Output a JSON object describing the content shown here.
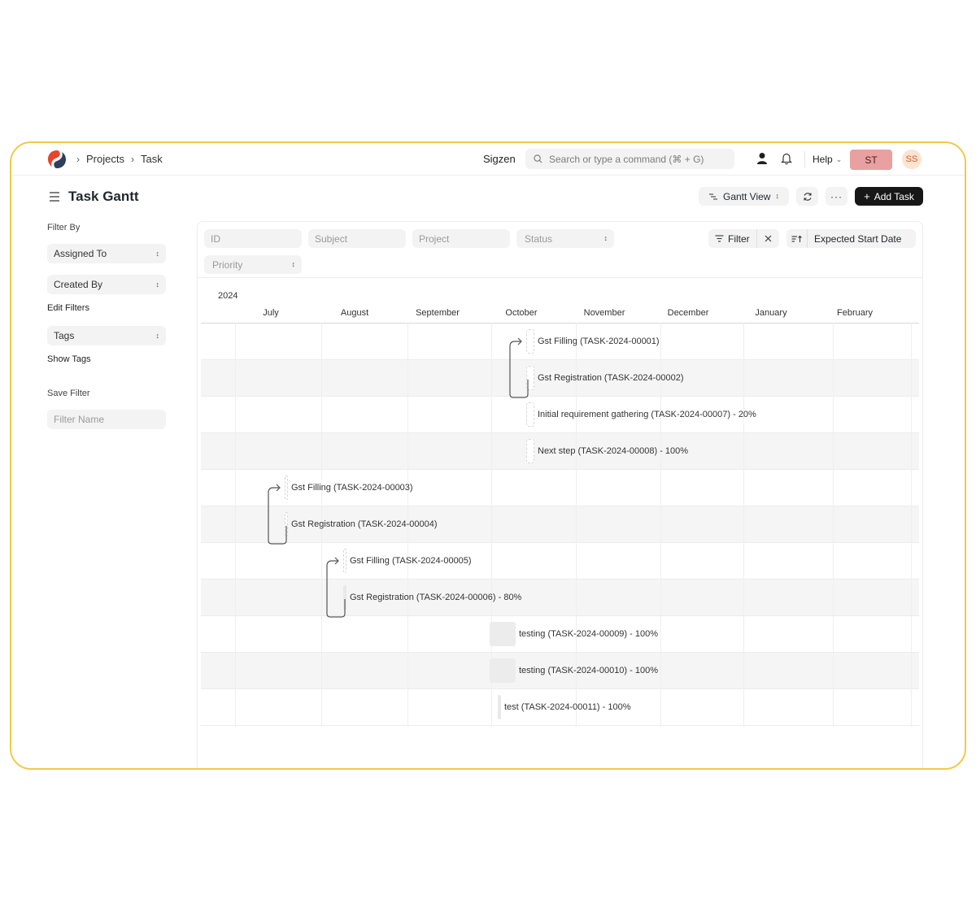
{
  "navbar": {
    "breadcrumbs": [
      "Projects",
      "Task"
    ],
    "org": "Sigzen",
    "search_placeholder": "Search or type a command (⌘ + G)",
    "help": "Help",
    "avatar_main": "ST",
    "avatar_user": "SS"
  },
  "page": {
    "title": "Task Gantt",
    "view_label": "Gantt View",
    "add_label": "Add Task"
  },
  "sidebar": {
    "filter_by": "Filter By",
    "assigned_to": "Assigned To",
    "created_by": "Created By",
    "edit_filters": "Edit Filters",
    "tags": "Tags",
    "show_tags": "Show Tags",
    "save_filter": "Save Filter",
    "filter_name_placeholder": "Filter Name"
  },
  "filters": {
    "id": "ID",
    "subject": "Subject",
    "project": "Project",
    "status": "Status",
    "priority": "Priority",
    "filter_label": "Filter",
    "sort_label": "Expected Start Date"
  },
  "gantt": {
    "year": "2024",
    "months": [
      "July",
      "August",
      "September",
      "October",
      "November",
      "December",
      "January",
      "February"
    ],
    "tasks": [
      {
        "label": "Gst Filling (TASK-2024-00001)"
      },
      {
        "label": "Gst Registration (TASK-2024-00002)"
      },
      {
        "label": "Initial requirement gathering (TASK-2024-00007) - 20%"
      },
      {
        "label": "Next step (TASK-2024-00008) - 100%"
      },
      {
        "label": "Gst Filling (TASK-2024-00003)"
      },
      {
        "label": "Gst Registration (TASK-2024-00004)"
      },
      {
        "label": "Gst Filling (TASK-2024-00005)"
      },
      {
        "label": "Gst Registration (TASK-2024-00006) - 80%"
      },
      {
        "label": "testing (TASK-2024-00009) - 100%"
      },
      {
        "label": "testing (TASK-2024-00010) - 100%"
      },
      {
        "label": "test (TASK-2024-00011) - 100%"
      }
    ]
  }
}
